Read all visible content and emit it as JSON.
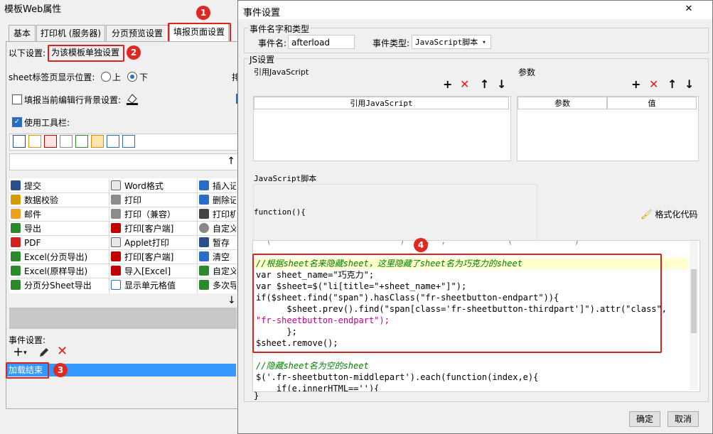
{
  "left_window": {
    "title": "模板Web属性",
    "tabs": [
      "基本",
      "打印机 (服务器)",
      "分页预览设置",
      "填报页面设置"
    ],
    "active_tab": "填报页面设置",
    "settings_label": "以下设置:",
    "settings_value": "为该模板单独设置",
    "sheet_pos_label": "sheet标签页显示位置:",
    "sheet_pos_options": [
      "上",
      "下"
    ],
    "sheet_pos_selected": "下",
    "fill_bg_label": "填报当前编辑行背景设置:",
    "use_toolbar_label": "使用工具栏:",
    "toolbar_items": [
      [
        "提交",
        "Word格式",
        "插入记"
      ],
      [
        "数据校验",
        "打印",
        "删除记"
      ],
      [
        "邮件",
        "打印（兼容）",
        "打印机"
      ],
      [
        "导出",
        "打印[客户端]",
        "自定义"
      ],
      [
        "PDF",
        "Applet打印",
        "暂存"
      ],
      [
        "Excel(分页导出)",
        "打印[客户端]",
        "清空"
      ],
      [
        "Excel(原样导出)",
        "导入[Excel]",
        "自定义"
      ],
      [
        "分页分Sheet导出",
        "显示单元格值",
        "多次导"
      ]
    ],
    "event_label": "事件设置:",
    "event_item": "加载结束",
    "truncated_right_label": "排"
  },
  "annotations": [
    "1",
    "2",
    "3",
    "4"
  ],
  "dialog": {
    "title": "事件设置",
    "close_glyph": "✕",
    "group_name_type": "事件名字和类型",
    "event_name_label": "事件名:",
    "event_name_value": "afterload",
    "event_type_label": "事件类型:",
    "event_type_value": "JavaScript脚本",
    "js_settings": "JS设置",
    "ref_js_label": "引用JavaScript",
    "ref_js_column": "引用JavaScript",
    "params_label": "参数",
    "params_columns": [
      "参数",
      "值"
    ],
    "js_script_label": "JavaScript脚本",
    "function_header": "function(){",
    "format_code": "格式化代码",
    "ok": "确定",
    "cancel": "取消",
    "code_partial_top": "  (                         )    ;  ;            (            )                ",
    "code_lines": [
      "//根据sheet名来隐藏sheet，这里隐藏了sheet名为巧克力的sheet",
      "var sheet_name=\"巧克力\";",
      "var $sheet=$(\"li[title=\"+sheet_name+\"]\");",
      "if($sheet.find(\"span\").hasClass(\"fr-sheetbutton-endpart\")){",
      "      $sheet.prev().find(\"span[class='fr-sheetbutton-thirdpart']\").attr(\"class\",",
      "\"fr-sheetbutton-endpart\");",
      "      };",
      "$sheet.remove();",
      "",
      "//隐藏sheet名为空的sheet",
      "$('.fr-sheetbutton-middlepart').each(function(index,e){",
      "    if(e.innerHTML==''){"
    ],
    "closing_brace": "}"
  }
}
